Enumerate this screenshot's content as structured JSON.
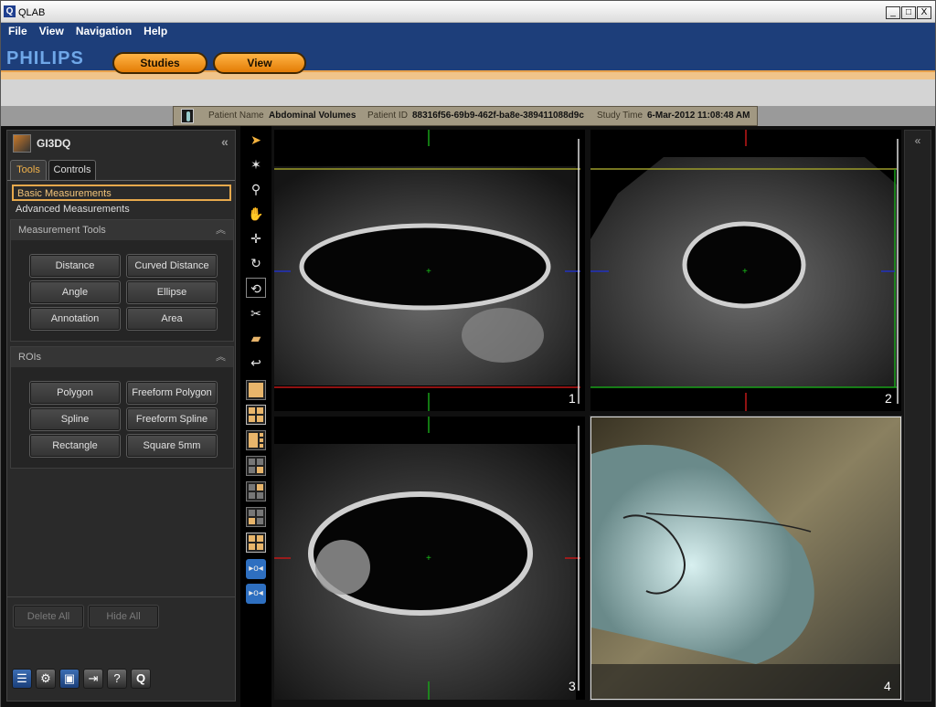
{
  "window": {
    "title": "QLAB",
    "minimize": "_",
    "maximize": "□",
    "close": "X"
  },
  "menu": [
    "File",
    "View",
    "Navigation",
    "Help"
  ],
  "brand": "PHILIPS",
  "nav_buttons": {
    "studies": "Studies",
    "view": "View"
  },
  "patient": {
    "name_label": "Patient Name",
    "name": "Abdominal Volumes",
    "id_label": "Patient ID",
    "id": "88316f56-69b9-462f-ba8e-389411088d9c",
    "time_label": "Study Time",
    "time": "6-Mar-2012 11:08:48 AM"
  },
  "panel": {
    "title": "GI3DQ",
    "collapse": "«",
    "tabs": [
      "Tools",
      "Controls"
    ],
    "categories": [
      "Basic Measurements",
      "Advanced Measurements"
    ],
    "measurement_tools": {
      "title": "Measurement Tools",
      "buttons": [
        "Distance",
        "Curved Distance",
        "Angle",
        "Ellipse",
        "Annotation",
        "Area"
      ]
    },
    "rois": {
      "title": "ROIs",
      "buttons": [
        "Polygon",
        "Freeform Polygon",
        "Spline",
        "Freeform Spline",
        "Rectangle",
        "Square 5mm"
      ]
    },
    "actions": [
      "Delete All",
      "Hide All"
    ],
    "footer_icons": [
      "series-icon",
      "settings-icon",
      "save-icon",
      "export-icon",
      "help-icon",
      "qlab-icon"
    ]
  },
  "viewports": {
    "labels": [
      "1",
      "2",
      "3",
      "4"
    ]
  },
  "right_collapse": "«",
  "colors": {
    "band": "#1d3e7a",
    "accent": "#f0a030",
    "brand": "#6fa7e8"
  }
}
